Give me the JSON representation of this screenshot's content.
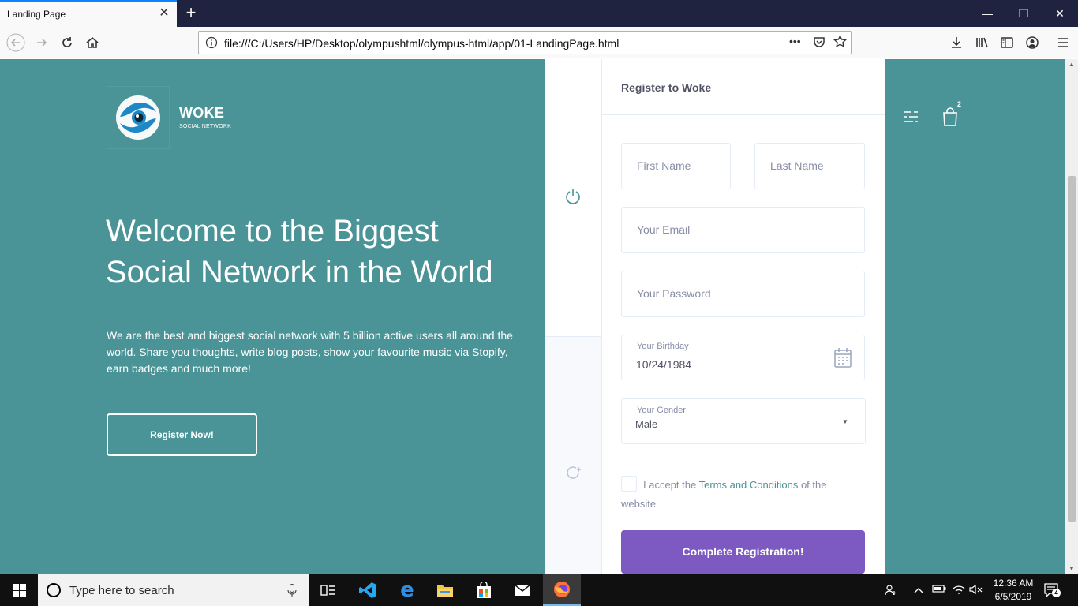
{
  "browser": {
    "tab_title": "Landing Page",
    "url": "file:///C:/Users/HP/Desktop/olympushtml/olympus-html/app/01-LandingPage.html",
    "accent": "#0a84ff"
  },
  "logo": {
    "title": "WOKE",
    "subtitle": "SOCIAL NETWORK"
  },
  "hero": {
    "title_line1": "Welcome to the Biggest",
    "title_line2": "Social Network in the World",
    "text": "We are the best and biggest social network with 5 billion active users all around the world. Share you thoughts, write blog posts, show your favourite music via Stopify, earn badges and much more!",
    "register_now": "Register Now!"
  },
  "header_icons": {
    "cart_count": "2"
  },
  "register": {
    "title": "Register to Woke",
    "first_name_placeholder": "First Name",
    "last_name_placeholder": "Last Name",
    "email_placeholder": "Your Email",
    "password_placeholder": "Your Password",
    "birthday_label": "Your Birthday",
    "birthday_value": "10/24/1984",
    "gender_label": "Your Gender",
    "gender_value": "Male",
    "terms_prefix": "I accept the ",
    "terms_link": "Terms and Conditions",
    "terms_suffix": " of the website",
    "submit": "Complete Registration!",
    "accent": "#7c5ac2"
  },
  "taskbar": {
    "search_placeholder": "Type here to search",
    "time": "12:36 AM",
    "date": "6/5/2019",
    "notification_count": "4"
  },
  "colors": {
    "page_bg": "#4a9396",
    "titlebar": "#202340"
  }
}
